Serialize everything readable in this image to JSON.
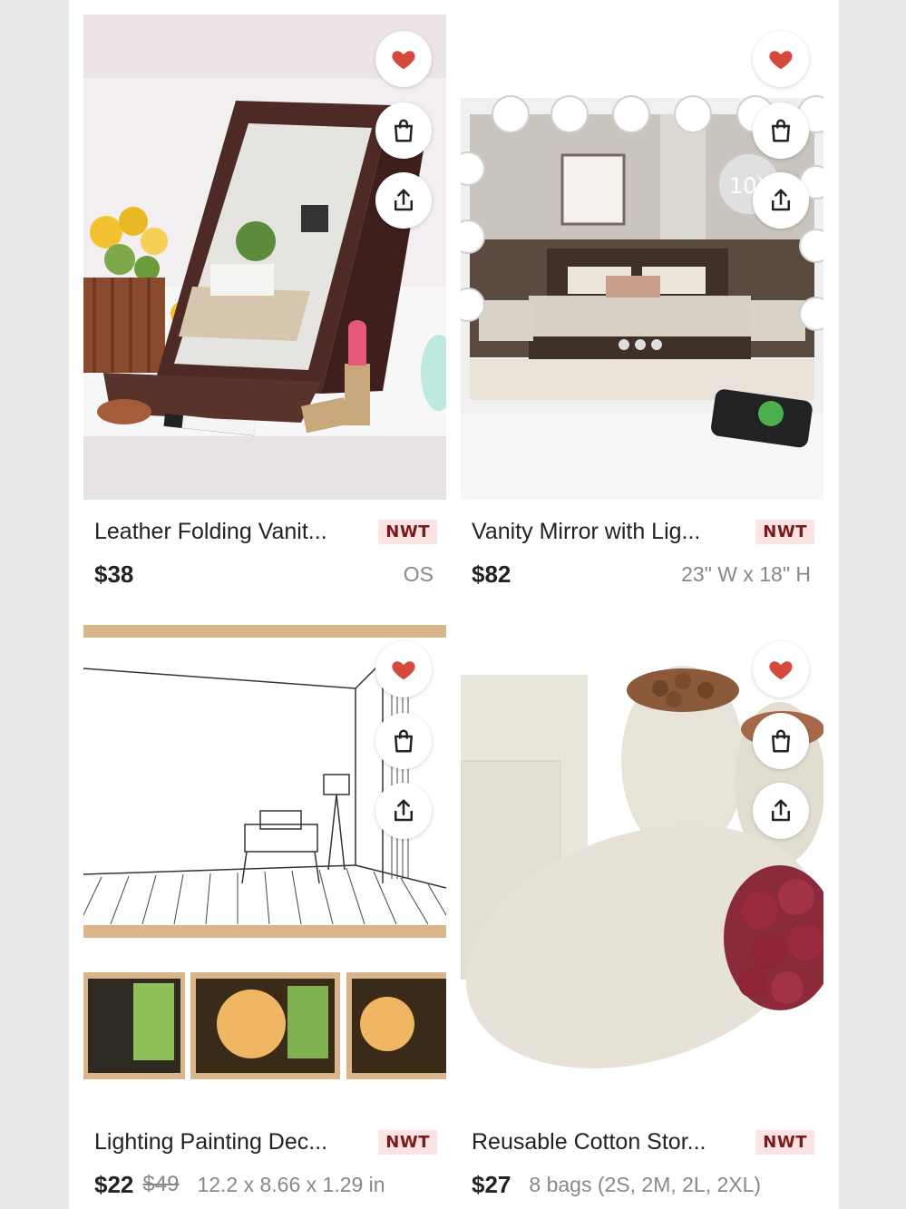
{
  "colors": {
    "heart": "#d64a3e",
    "nwt_bg": "#fde3e3",
    "nwt_text": "#7a1a1a"
  },
  "icons": {
    "like": "heart-icon",
    "bag": "shopping-bag-icon",
    "share": "share-icon"
  },
  "listings": [
    {
      "title": "Leather Folding Vanit...",
      "badge": "NWT",
      "price": "$38",
      "original_price": "",
      "size": "OS",
      "image": "folding-leather-mirror"
    },
    {
      "title": "Vanity Mirror with Lig...",
      "badge": "NWT",
      "price": "$82",
      "original_price": "",
      "size": "23\" W x 18\" H",
      "image": "lighted-vanity-mirror",
      "image_text": "10X"
    },
    {
      "title": "Lighting Painting Dec...",
      "badge": "NWT",
      "price": "$22",
      "original_price": "$49",
      "size": "12.2 x 8.66 x 1.29 in",
      "image": "sketch-lighting-painting"
    },
    {
      "title": "Reusable Cotton Stor...",
      "badge": "NWT",
      "price": "$27",
      "original_price": "",
      "size": "8 bags (2S, 2M, 2L, 2XL)",
      "image": "cotton-storage-bags"
    }
  ]
}
